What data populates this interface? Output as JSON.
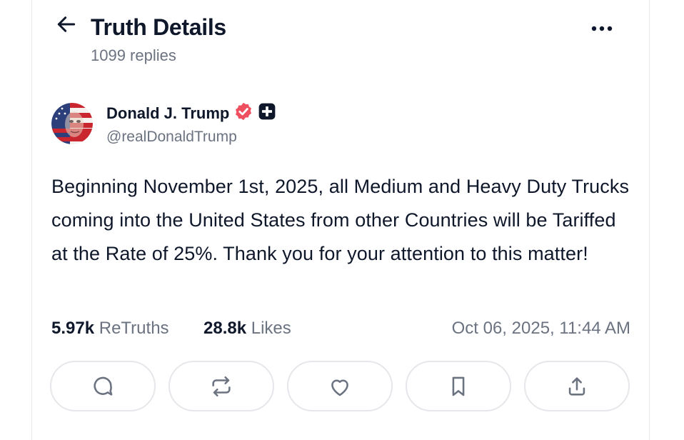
{
  "header": {
    "title": "Truth Details",
    "replies": "1099 replies",
    "back_icon": "arrow-left-icon",
    "more_icon": "more-horizontal-icon"
  },
  "post": {
    "author": {
      "name": "Donald J. Trump",
      "handle": "@realDonaldTrump",
      "verified_icon": "verified-badge-icon",
      "badge_icon": "plus-badge-icon",
      "verified_color": "#ef4f5f"
    },
    "text": "Beginning November 1st, 2025, all Medium and Heavy Duty Trucks coming into the United States from other Countries will be Tariffed at the Rate of 25%. Thank you for your attention to this matter!",
    "stats": {
      "retruths_count": "5.97k",
      "retruths_label": "ReTruths",
      "likes_count": "28.8k",
      "likes_label": "Likes",
      "timestamp": "Oct 06, 2025, 11:44 AM"
    }
  },
  "actions": [
    {
      "icon": "reply-icon"
    },
    {
      "icon": "retruth-icon"
    },
    {
      "icon": "like-icon"
    },
    {
      "icon": "bookmark-icon"
    },
    {
      "icon": "share-icon"
    }
  ]
}
